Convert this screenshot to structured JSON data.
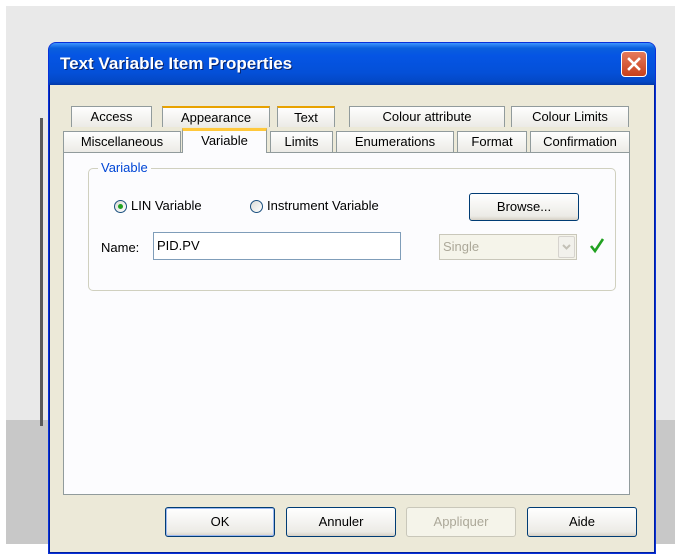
{
  "window": {
    "title": "Text Variable Item Properties"
  },
  "tabs_row1": [
    "Access",
    "Appearance",
    "Text",
    "Colour attribute",
    "Colour Limits"
  ],
  "tabs_row2": [
    "Miscellaneous",
    "Variable",
    "Limits",
    "Enumerations",
    "Format",
    "Confirmation"
  ],
  "active_tab": "Variable",
  "variable_group": {
    "caption": "Variable",
    "radio_lin": {
      "label": "LIN Variable",
      "checked": true
    },
    "radio_instrument": {
      "label": "Instrument Variable",
      "checked": false
    },
    "browse_label": "Browse...",
    "name_label": "Name:",
    "name_value": "PID.PV",
    "type_select": {
      "value": "Single",
      "disabled": true
    }
  },
  "buttons": {
    "ok": "OK",
    "cancel": "Annuler",
    "apply": "Appliquer",
    "help": "Aide"
  },
  "colors": {
    "title_bar": "#0450d8",
    "dialog_bg": "#ece9d8",
    "group_caption": "#0046d5",
    "check": "#21a121"
  }
}
